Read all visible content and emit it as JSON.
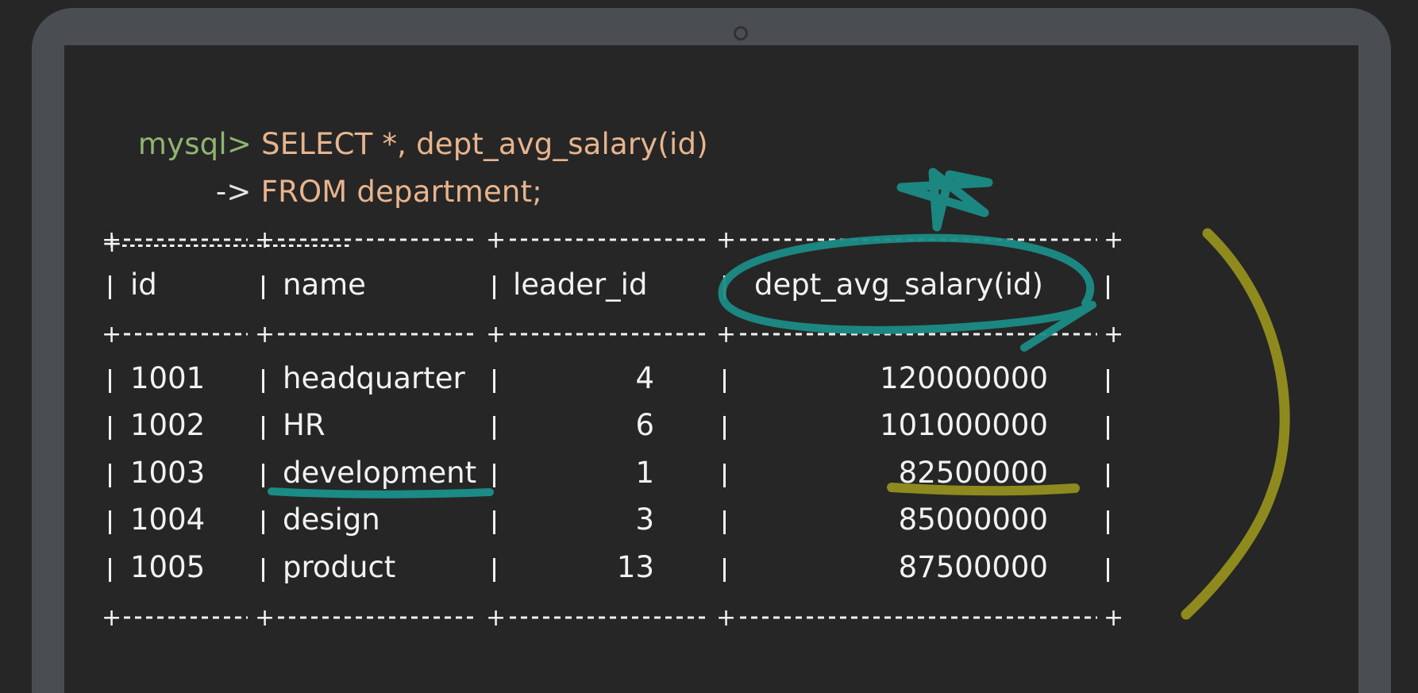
{
  "terminal": {
    "prompt": "mysql>",
    "line1_sql": "SELECT *, dept_avg_salary(id)",
    "continuation_prompt": "->",
    "line2_sql": "FROM department;"
  },
  "table": {
    "columns": [
      "id",
      "name",
      "leader_id",
      "dept_avg_salary(id)"
    ],
    "rows": [
      {
        "id": "1001",
        "name": "headquarter",
        "leader_id": "4",
        "avg": "120000000"
      },
      {
        "id": "1002",
        "name": "HR",
        "leader_id": "6",
        "avg": "101000000"
      },
      {
        "id": "1003",
        "name": "development",
        "leader_id": "1",
        "avg": "82500000"
      },
      {
        "id": "1004",
        "name": "design",
        "leader_id": "3",
        "avg": "85000000"
      },
      {
        "id": "1005",
        "name": "product",
        "leader_id": "13",
        "avg": "87500000"
      }
    ]
  },
  "colors": {
    "prompt": "#8fb571",
    "sql": "#e8b48d",
    "teal_annotation": "#1b8b86",
    "olive_annotation": "#8e8a1e"
  },
  "icons": {
    "camera": "camera-icon",
    "star": "star-doodle-icon",
    "arc": "bracket-arc-doodle-icon"
  }
}
